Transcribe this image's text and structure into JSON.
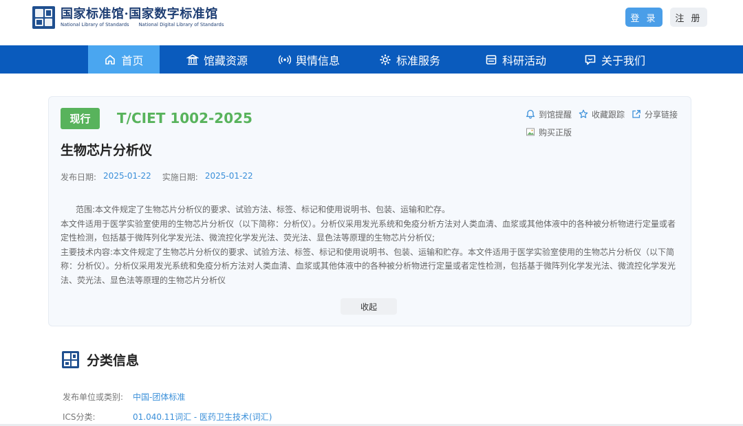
{
  "header": {
    "logo_cn": "国家标准馆·国家数字标准馆",
    "logo_en_left": "National Library of Standards",
    "logo_en_right": "National Digital Library of Standards",
    "login_label": "登 录",
    "register_label": "注 册"
  },
  "nav": {
    "items": [
      {
        "label": "首页",
        "icon": "home-icon",
        "active": true
      },
      {
        "label": "馆藏资源",
        "icon": "library-icon"
      },
      {
        "label": "舆情信息",
        "icon": "broadcast-icon"
      },
      {
        "label": "标准服务",
        "icon": "gear-icon"
      },
      {
        "label": "科研活动",
        "icon": "research-icon"
      },
      {
        "label": "关于我们",
        "icon": "chat-icon"
      }
    ]
  },
  "standard": {
    "status": "现行",
    "code": "T/CIET 1002-2025",
    "title": "生物芯片分析仪",
    "publish_label": "发布日期:",
    "publish_date": "2025-01-22",
    "implement_label": "实施日期:",
    "implement_date": "2025-01-22",
    "actions": {
      "remind": "到馆提醒",
      "follow": "收藏跟踪",
      "share": "分享链接",
      "buy": "购买正版"
    },
    "description": [
      "范围:本文件规定了生物芯片分析仪的要求、试验方法、标签、标记和使用说明书、包装、运输和贮存。",
      "本文件适用于医学实验室使用的生物芯片分析仪（以下简称：分析仪）。分析仪采用发光系统和免疫分析方法对人类血清、血浆或其他体液中的各种被分析物进行定量或者定性检测，包括基于微阵列化学发光法、微流控化学发光法、荧光法、显色法等原理的生物芯片分析仪;",
      "主要技术内容:本文件规定了生物芯片分析仪的要求、试验方法、标签、标记和使用说明书、包装、运输和贮存。本文件适用于医学实验室使用的生物芯片分析仪（以下简称：分析仪）。分析仪采用发光系统和免疫分析方法对人类血清、血浆或其他体液中的各种被分析物进行定量或者定性检测，包括基于微阵列化学发光法、微流控化学发光法、荧光法、显色法等原理的生物芯片分析仪"
    ],
    "collapse_label": "收起"
  },
  "classification": {
    "title": "分类信息",
    "rows": [
      {
        "label": "发布单位或类别:",
        "value": "中国-团体标准"
      },
      {
        "label": "ICS分类:",
        "value": "01.040.11词汇 - 医药卫生技术(词汇)"
      }
    ]
  },
  "colors": {
    "nav_bg": "#0a5bbd",
    "nav_active": "#4aa6f0",
    "status_green": "#58b35c",
    "link_blue": "#3a8fd9"
  }
}
